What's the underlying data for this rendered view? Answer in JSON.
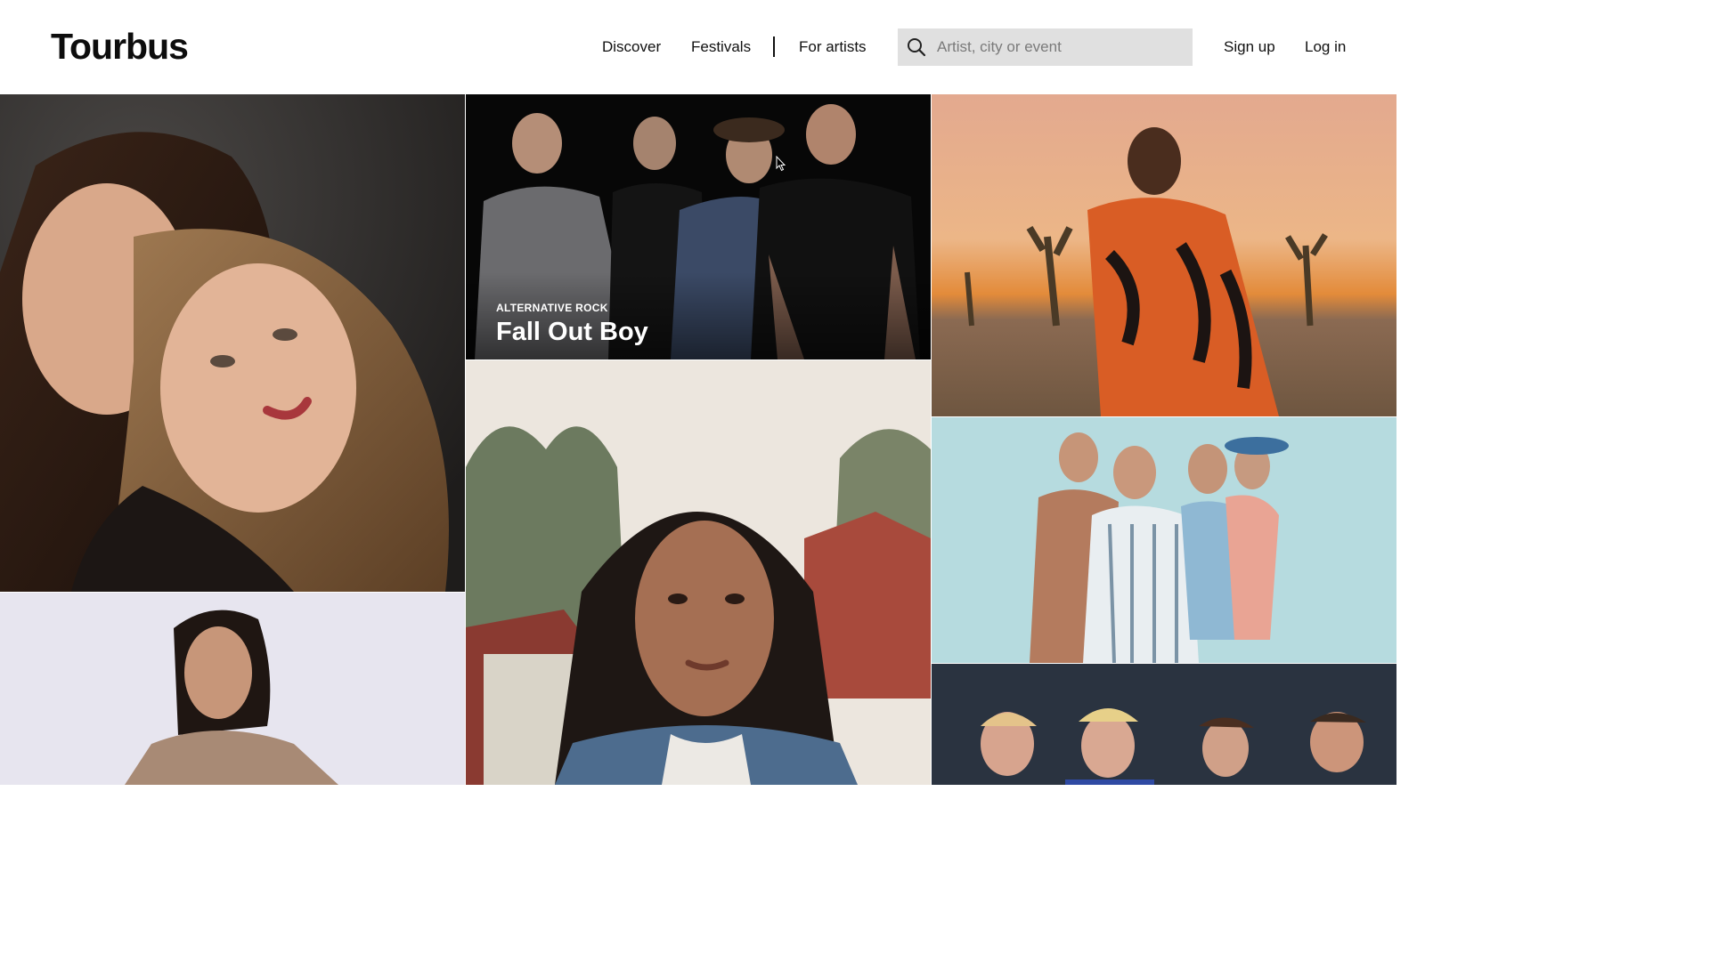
{
  "header": {
    "logo": "Tourbus",
    "nav": {
      "discover": "Discover",
      "festivals": "Festivals",
      "for_artists": "For artists"
    },
    "search": {
      "placeholder": "Artist, city or event",
      "icon": "search-icon"
    },
    "auth": {
      "sign_up": "Sign up",
      "log_in": "Log in"
    }
  },
  "grid": {
    "tiles": [
      {
        "id": "duo-portrait",
        "caption": null
      },
      {
        "id": "fall-out-boy",
        "caption": {
          "genre": "ALTERNATIVE ROCK",
          "name": "Fall Out Boy"
        }
      },
      {
        "id": "desert-portrait",
        "caption": null
      },
      {
        "id": "woman-portrait-light",
        "caption": null
      },
      {
        "id": "woman-portrait-outdoor",
        "caption": null
      },
      {
        "id": "band-four-light",
        "caption": null
      },
      {
        "id": "band-four-dark",
        "caption": null
      }
    ]
  },
  "colors": {
    "header_bg": "#ffffff",
    "search_bg": "#e0e0e0",
    "text": "#111111",
    "caption_text": "#ffffff"
  }
}
